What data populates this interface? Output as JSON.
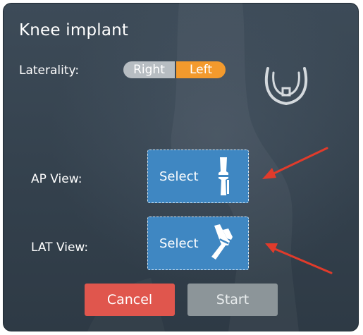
{
  "dialog": {
    "title": "Knee implant",
    "laterality": {
      "label": "Laterality:",
      "options": [
        "Right",
        "Left"
      ],
      "selected": "Left"
    },
    "views": [
      {
        "label": "AP View:",
        "button_label": "Select",
        "icon": "leg-straight-icon"
      },
      {
        "label": "LAT View:",
        "button_label": "Select",
        "icon": "leg-bent-icon"
      }
    ],
    "buttons": {
      "cancel": "Cancel",
      "start": "Start"
    }
  },
  "colors": {
    "background": "#36434f",
    "accent_orange": "#f39a2d",
    "select_blue": "#3f87c2",
    "cancel_red": "#e0564d",
    "start_gray": "#8c9599",
    "annotation_arrow": "#e03b2b"
  }
}
